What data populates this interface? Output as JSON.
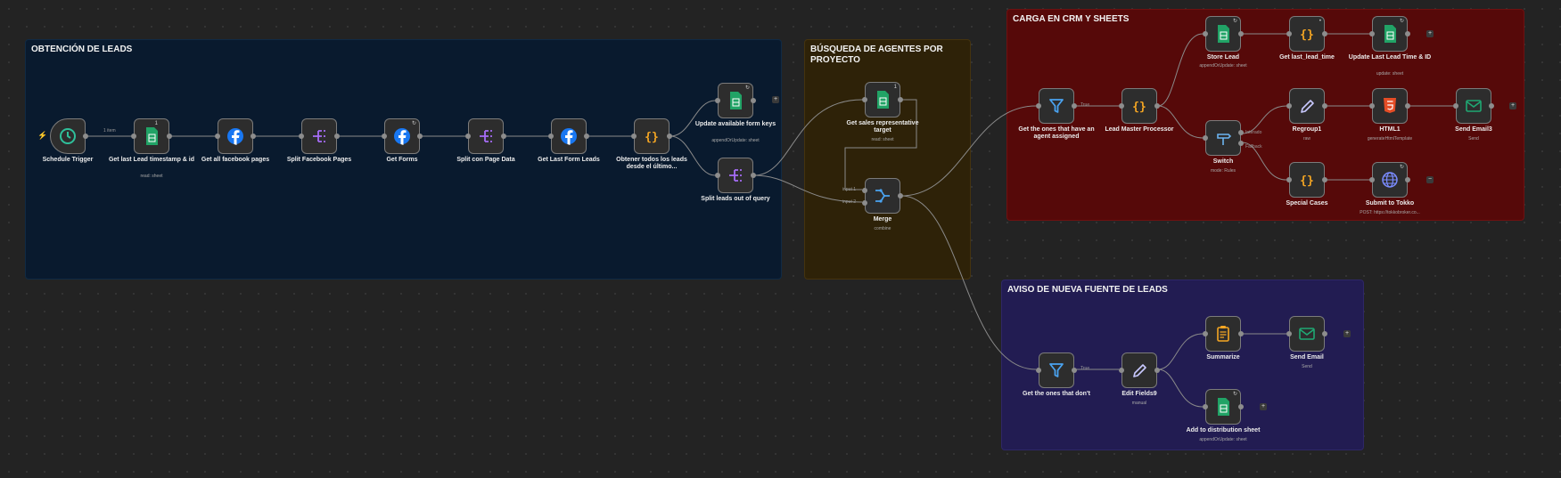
{
  "groups": {
    "obtencion": "OBTENCIÓN DE LEADS",
    "busqueda": "BÚSQUEDA DE AGENTES POR PROYECTO",
    "carga": "CARGA EN CRM Y SHEETS",
    "aviso": "AVISO DE NUEVA FUENTE DE LEADS"
  },
  "nodes": {
    "schedule_trigger": {
      "label": "Schedule Trigger"
    },
    "get_last_lead": {
      "label": "Get last Lead timestamp & id",
      "sub": "read: sheet",
      "badge": "1"
    },
    "get_fb_pages": {
      "label": "Get all facebook pages"
    },
    "split_fb_pages": {
      "label": "Split Facebook Pages"
    },
    "get_forms": {
      "label": "Get Forms"
    },
    "split_page_data": {
      "label": "Split con Page Data"
    },
    "get_last_form_leads": {
      "label": "Get Last Form Leads"
    },
    "obtener_leads": {
      "label": "Obtener todos los leads desde el último..."
    },
    "update_form_keys": {
      "label": "Update available form keys",
      "sub": "appendOrUpdate: sheet"
    },
    "split_leads_query": {
      "label": "Split leads out of query"
    },
    "get_sales_rep": {
      "label": "Get sales representative target",
      "sub": "read: sheet",
      "badge": "1"
    },
    "merge": {
      "label": "Merge",
      "sub": "combine",
      "in1": "input 1",
      "in2": "input 2"
    },
    "get_with_agent": {
      "label": "Get the ones that have an agent assigned"
    },
    "lead_master": {
      "label": "Lead Master Processor"
    },
    "store_lead": {
      "label": "Store Lead",
      "sub": "appendOrUpdate: sheet"
    },
    "get_last_lead_time": {
      "label": "Get last_lead_time"
    },
    "update_last_lead": {
      "label": "Update Last Lead Time & ID",
      "sub": "update: sheet"
    },
    "switch": {
      "label": "Switch",
      "sub": "mode: Rules",
      "out1": "Interado",
      "out2": "Fallback"
    },
    "regroup": {
      "label": "Regroup1",
      "sub": "raw"
    },
    "html1": {
      "label": "HTML1",
      "sub": "generateHtmlTemplate"
    },
    "send_email3": {
      "label": "Send Email3",
      "sub": "Send"
    },
    "special_cases": {
      "label": "Special Cases"
    },
    "submit_tokko": {
      "label": "Submit to Tokko",
      "sub": "POST: https://tokkobroker.co..."
    },
    "get_without": {
      "label": "Get the ones that don't"
    },
    "edit_fields9": {
      "label": "Edit Fields9",
      "sub": "manual"
    },
    "summarize": {
      "label": "Summarize"
    },
    "send_email": {
      "label": "Send Email",
      "sub": "Send"
    },
    "add_distribution": {
      "label": "Add to distribution sheet",
      "sub": "appendOrUpdate: sheet"
    }
  },
  "wire_labels": {
    "one_item": "1 item",
    "true1": "True",
    "true2": "True"
  },
  "colors": {
    "sheets": "#21a366",
    "facebook": "#1877f2",
    "code": "#f5a623",
    "split": "#a56cf5",
    "filter": "#4aa3f0",
    "clock": "#2fbf9a",
    "html": "#e44d26",
    "email": "#1fa873",
    "globe": "#7b8cff",
    "summarize": "#f5a623",
    "edit": "#c9c9ff",
    "switch": "#6cb4f0",
    "merge": "#4aa3f0"
  }
}
